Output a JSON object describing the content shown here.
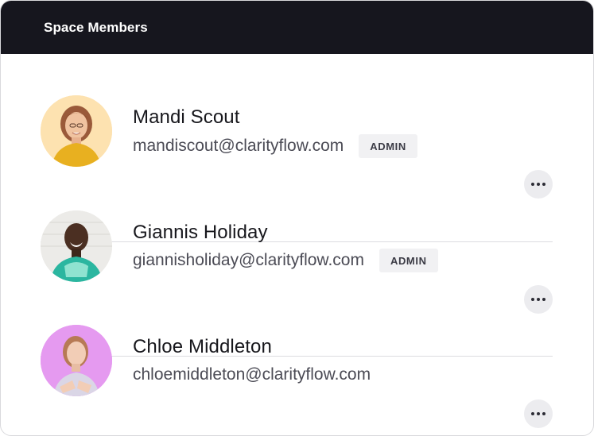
{
  "header": {
    "title": "Space Members"
  },
  "members": [
    {
      "name": "Mandi Scout",
      "email": "mandiscout@clarityflow.com",
      "role": "ADMIN",
      "avatar_bg": "#fde2b0"
    },
    {
      "name": "Giannis Holiday",
      "email": "giannisholiday@clarityflow.com",
      "role": "ADMIN",
      "avatar_bg": "#ecebe8"
    },
    {
      "name": "Chloe Middleton",
      "email": "chloemiddleton@clarityflow.com",
      "role": "",
      "avatar_bg": "#e59af0"
    }
  ],
  "more_icon": "more-horizontal-icon"
}
